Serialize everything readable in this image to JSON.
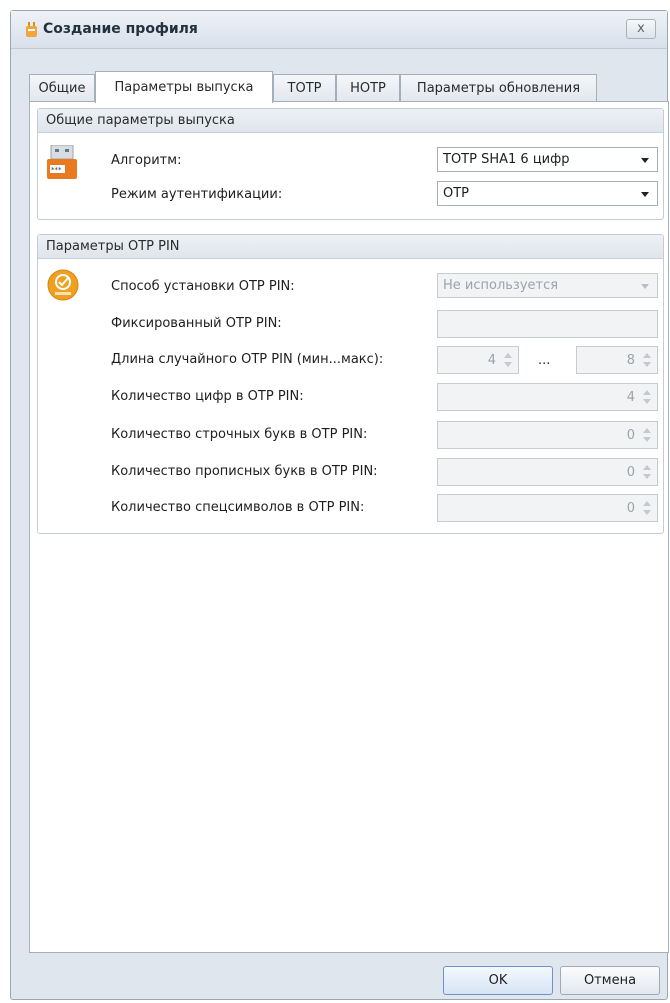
{
  "window": {
    "title": "Создание профиля",
    "close_label": "x"
  },
  "tabs": [
    {
      "label": "Общие",
      "active": false
    },
    {
      "label": "Параметры выпуска",
      "active": true
    },
    {
      "label": "TOTP",
      "active": false
    },
    {
      "label": "HOTP",
      "active": false
    },
    {
      "label": "Параметры обновления",
      "active": false
    }
  ],
  "issue_params": {
    "header": "Общие параметры выпуска",
    "icon_text": "***",
    "algorithm_label": "Алгоритм:",
    "algorithm_value": "TOTP SHA1 6 цифр",
    "auth_mode_label": "Режим аутентификации:",
    "auth_mode_value": "OTP"
  },
  "otp_pin": {
    "header": "Параметры OTP PIN",
    "install_method_label": "Способ установки OTP PIN:",
    "install_method_value": "Не используется",
    "fixed_pin_label": "Фиксированный OTP PIN:",
    "random_length_label": "Длина случайного OTP PIN (мин...макс):",
    "random_length_min": "4",
    "random_length_sep": "...",
    "random_length_max": "8",
    "digits_label": "Количество цифр в OTP PIN:",
    "digits_value": "4",
    "lowercase_label": "Количество строчных букв в OTP PIN:",
    "lowercase_value": "0",
    "uppercase_label": "Количество прописных букв в OTP PIN:",
    "uppercase_value": "0",
    "special_label": "Количество спецсимволов в OTP PIN:",
    "special_value": "0"
  },
  "buttons": {
    "ok": "OK",
    "cancel": "Отмена"
  }
}
